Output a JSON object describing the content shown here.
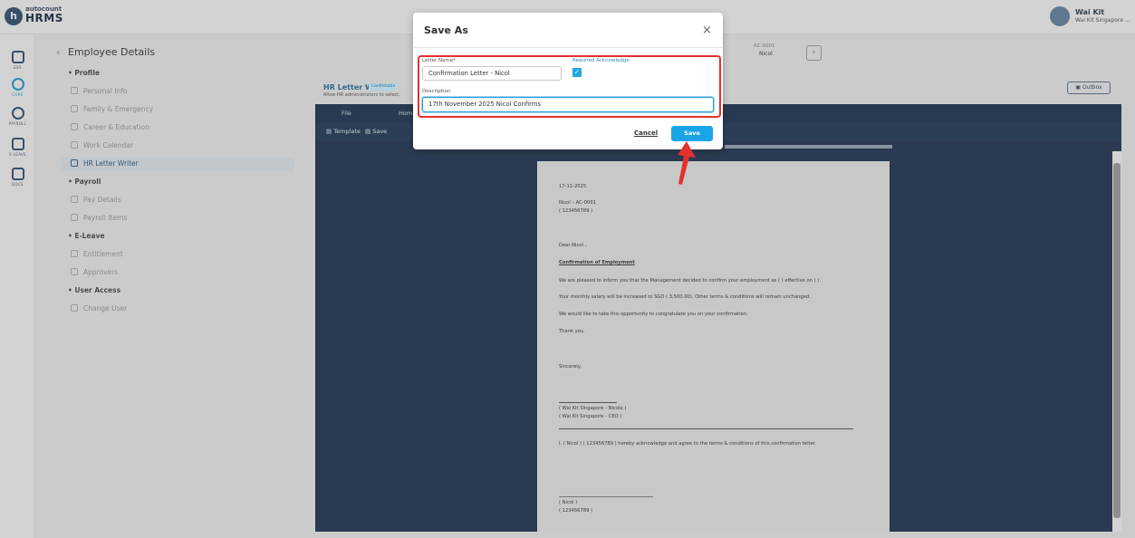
{
  "brand": {
    "line1": "autocount",
    "line2": "HRMS",
    "mark": "h"
  },
  "user": {
    "name": "Wai Kit",
    "company": "Wai Kit Singapore ..."
  },
  "nav": [
    {
      "label": "ESS",
      "icon": "ess-icon"
    },
    {
      "label": "CORE",
      "icon": "core-icon"
    },
    {
      "label": "PAYROLL",
      "icon": "payroll-icon"
    },
    {
      "label": "E-LEAVE",
      "icon": "calendar-icon"
    },
    {
      "label": "DOCS",
      "icon": "docs-icon"
    }
  ],
  "page": {
    "back": "‹",
    "title": "Employee Details"
  },
  "tree": [
    {
      "label": "Profile",
      "section": true
    },
    {
      "label": "Personal Info"
    },
    {
      "label": "Family & Emergency"
    },
    {
      "label": "Career & Education"
    },
    {
      "label": "Work Calendar"
    },
    {
      "label": "HR Letter Writer",
      "active": true
    },
    {
      "label": "Payroll",
      "section": true
    },
    {
      "label": "Pay Details"
    },
    {
      "label": "Payroll Items"
    },
    {
      "label": "E-Leave",
      "section": true
    },
    {
      "label": "Entitlement"
    },
    {
      "label": "Approvers"
    },
    {
      "label": "User Access",
      "section": true
    },
    {
      "label": "Change User"
    }
  ],
  "employee": {
    "code": "AC-0001",
    "name": "Nicol",
    "next": "›"
  },
  "hr_writer": {
    "title": "HR Letter Writer",
    "badge": "Confirmatio",
    "subtitle": "Allow HR administrators to select,",
    "outbox": "Outbox",
    "tabs": [
      "File",
      "Hom"
    ],
    "actions": [
      "Template",
      "Save"
    ]
  },
  "letter": {
    "date": "17-11-2025",
    "emp_line": "Nicol  – AC-0001",
    "id_line": "( 123456789 )",
    "greeting": "Dear Nicol ,",
    "subject": "Confirmation of Employment",
    "para1": "We are pleased to inform you that the Management decided to confirm your employment as (  ) effective on (  ).",
    "para2": "Your monthly salary will be increased to SGD ( 3,500.00). Other terms & conditions will remain unchanged.",
    "para3": "We would like to take this opportunity to congratulate you on your confirmation.",
    "thanks": "Thank you.",
    "closing": "Sincerely,",
    "sign1": "( Wai Kit Singapore  - Nicole )",
    "sign2": "( Wai Kit Singapore  - CEO )",
    "ack": "I, ( Nicol  ) ( 123456789 ) hereby acknowledge and agree to the terms & conditions of this confirmation letter.",
    "emp_sign1": "( Nicol  )",
    "emp_sign2": "( 123456789 )"
  },
  "modal": {
    "title": "Save As",
    "close": "×",
    "letter_name_label": "Letter Name*",
    "letter_name_value": "Confirmation Letter - Nicol",
    "required_ack_label": "Required Acknowledge",
    "required_ack_checked": true,
    "check_mark": "✓",
    "description_label": "Description",
    "description_value": "17th November 2025 Nicol Confirms",
    "cancel": "Cancel",
    "save": "Save"
  },
  "colors": {
    "accent": "#19a5e5",
    "highlight": "#e3322d",
    "ribbon": "#283a51"
  }
}
